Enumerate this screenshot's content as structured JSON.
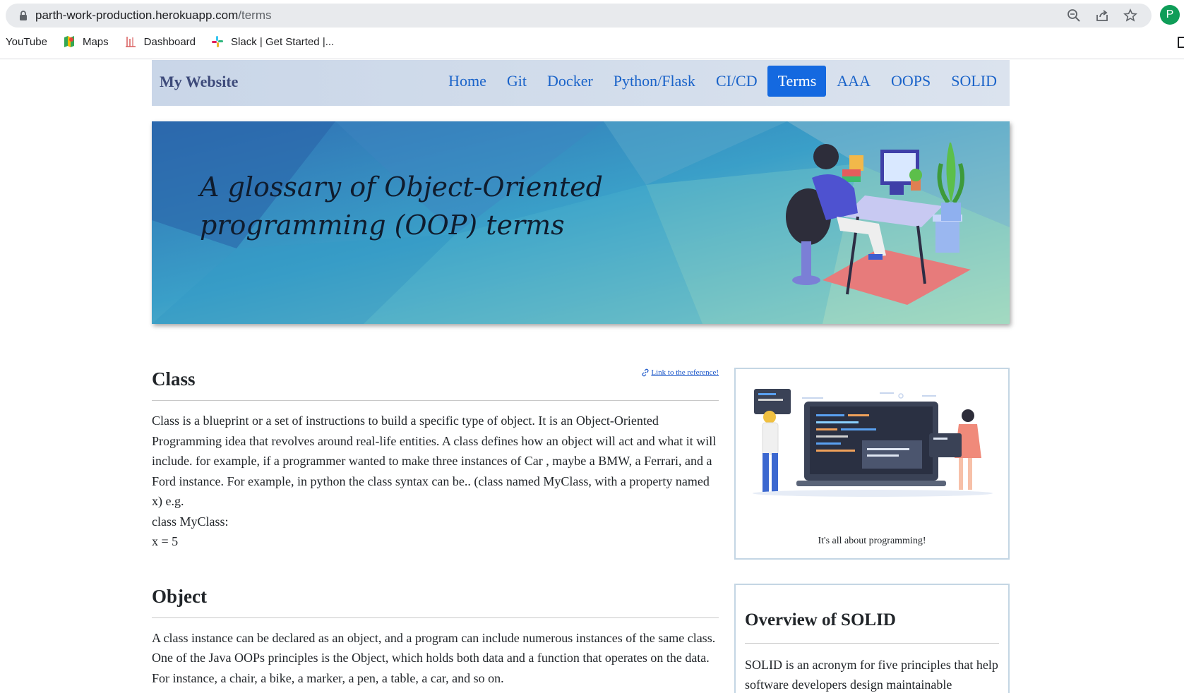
{
  "browser": {
    "url_host": "parth-work-production.herokuapp.com",
    "url_path": "/terms",
    "profile_initial": "P",
    "bookmarks": [
      {
        "label": "YouTube",
        "icon": "youtube-icon"
      },
      {
        "label": "Maps",
        "icon": "maps-icon"
      },
      {
        "label": "Dashboard",
        "icon": "dashboard-icon"
      },
      {
        "label": "Slack | Get Started |...",
        "icon": "slack-icon"
      }
    ]
  },
  "navbar": {
    "brand": "My Website",
    "items": [
      "Home",
      "Git",
      "Docker",
      "Python/Flask",
      "CI/CD",
      "Terms",
      "AAA",
      "OOPS",
      "SOLID"
    ],
    "active": "Terms",
    "colors": {
      "link": "#1a63c9",
      "active_bg": "#1469e0",
      "bar": "#d3ddea"
    }
  },
  "banner": {
    "line1": "A glossary of Object-Oriented",
    "line2": "programming (OOP) terms"
  },
  "sections": {
    "class": {
      "title": "Class",
      "ref_link": "Link to the reference!",
      "body": "Class is a blueprint or a set of instructions to build a specific type of object. It is an Object-Oriented Programming idea that revolves around real-life entities. A class defines how an object will act and what it will include. for example, if a programmer wanted to make three instances of Car , maybe a BMW, a Ferrari, and a Ford instance. For example, in python the class syntax can be.. (class named MyClass, with a property named x) e.g.",
      "code_line1": "class MyClass:",
      "code_line2": "x = 5"
    },
    "object": {
      "title": "Object",
      "body": "A class instance can be declared as an object, and a program can include numerous instances of the same class. One of the Java OOPs principles is the Object, which holds both data and a function that operates on the data. For instance, a chair, a bike, a marker, a pen, a table, a car, and so on."
    }
  },
  "sidebar": {
    "image_caption": "It's all about programming!",
    "solid_title": "Overview of SOLID",
    "solid_body": "SOLID is an acronym for five principles that help software developers design maintainable"
  }
}
